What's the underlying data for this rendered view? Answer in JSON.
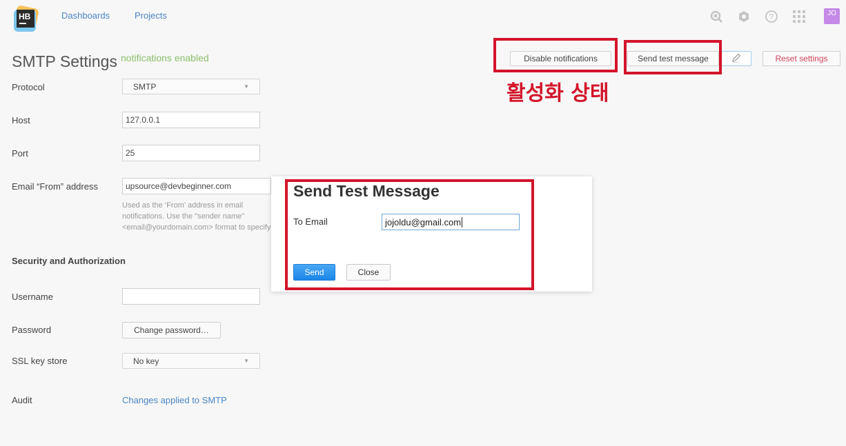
{
  "header": {
    "nav": [
      "Dashboards",
      "Projects"
    ],
    "logo_text": "HB",
    "avatar_text": "JO",
    "icons": [
      "search-icon",
      "settings-icon",
      "help-icon",
      "apps-grid-icon"
    ]
  },
  "page": {
    "title": "SMTP Settings",
    "status": "notifications enabled"
  },
  "toolbar": {
    "disable_label": "Disable notifications",
    "send_test_label": "Send test message",
    "edit_icon": "pencil-icon",
    "reset_label": "Reset settings"
  },
  "annotation": {
    "text": "활성화 상태",
    "color": "#d3142a"
  },
  "form": {
    "protocol_label": "Protocol",
    "protocol_value": "SMTP",
    "host_label": "Host",
    "host_value": "127.0.0.1",
    "port_label": "Port",
    "port_value": "25",
    "from_label": "Email “From” address",
    "from_value": "upsource@devbeginner.com",
    "from_hint": "Used as the ‘From’ address in email notifications. Use the \"sender name\" <email@yourdomain.com> format to specify the address.",
    "security_title": "Security and Authorization",
    "username_label": "Username",
    "username_value": "",
    "password_label": "Password",
    "password_button": "Change password…",
    "ssl_label": "SSL key store",
    "ssl_value": "No key",
    "audit_label": "Audit",
    "audit_link": "Changes applied to SMTP"
  },
  "dialog": {
    "title": "Send Test Message",
    "to_label": "To Email",
    "to_value": "jojoldu@gmail.com",
    "send_label": "Send",
    "close_label": "Close"
  },
  "colors": {
    "link": "#4a86c5",
    "status_green": "#8ac06a",
    "reset_red": "#d0455a",
    "primary_blue": "#1b86e8"
  }
}
